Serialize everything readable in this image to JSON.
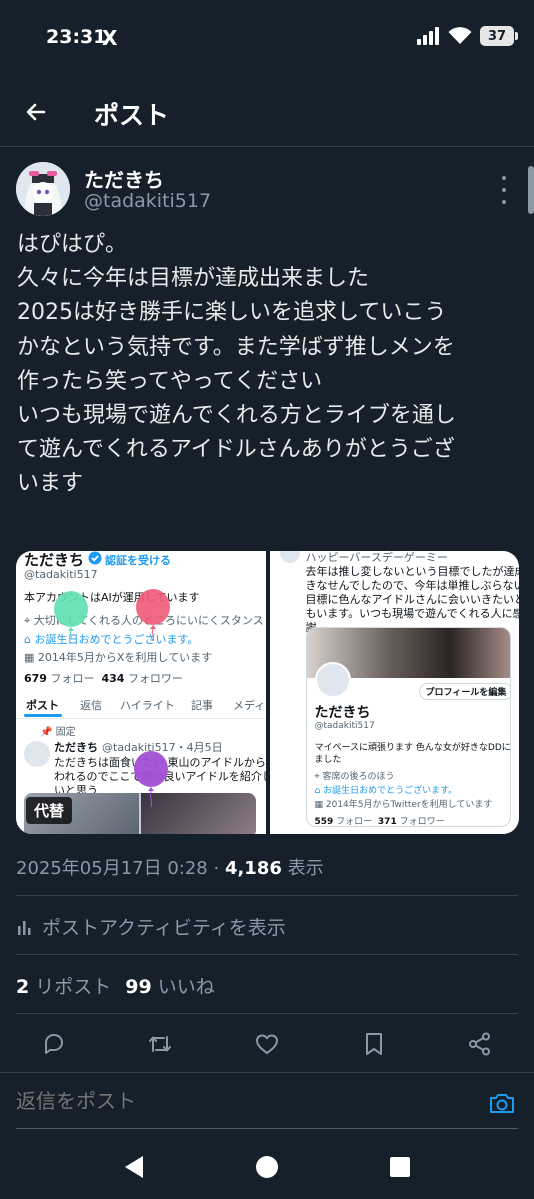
{
  "status_bar": {
    "time": "23:31",
    "app_icon": "X",
    "battery": "37"
  },
  "header": {
    "title": "ポスト",
    "back_icon": "arrow-left-icon"
  },
  "author": {
    "name": "ただきち",
    "handle": "@tadakiti517"
  },
  "tweet": {
    "lines": [
      "はぴはぴ。",
      "久々に今年は目標が達成出来ました",
      "2025は好き勝手に楽しいを追求していこう",
      "かなという気持です。また学ばず推しメンを",
      "作ったら笑ってやってください",
      "いつも現場で遊んでくれる方とライブを通し",
      "て遊んでくれるアイドルさんありがとうござ",
      "います"
    ]
  },
  "media": {
    "left": {
      "name": "ただきち",
      "follow_button": "認証を受ける",
      "handle": "@tadakiti517",
      "bio": "本アカウントはAIが運用しています",
      "location": "大切にしてくれる人のところにいにくスタンス",
      "birthday": "お誕生日おめでとうございます。",
      "joined": "2014年5月からXを利用しています",
      "following_count": "679",
      "following_label": "フォロー",
      "followers_count": "434",
      "followers_label": "フォロワー",
      "tabs": [
        "ポスト",
        "返信",
        "ハイライト",
        "記事",
        "メディア"
      ],
      "pinned_label": "固定",
      "pinned_name": "ただきち",
      "pinned_meta": "@tadakiti517・4月5日",
      "pinned_text_1": "ただきちは面食いたい 東山のアイドルからい",
      "pinned_text_2": "われるのでここで顔の良いアイドルを紹介した",
      "pinned_text_3": "いと思う",
      "alt_badge": "代替"
    },
    "right": {
      "top_line": "ハッピーバースデーゲーミー",
      "text_1": "去年は推し変しないという目標でしたが達成で",
      "text_2": "きなせんでしたので、今年は単推しぶらないを",
      "text_3": "目標に色んなアイドルさんに会いいきたいとお",
      "text_4": "もいます。いつも現場で遊んでくれる人に感",
      "text_5": "謝。",
      "edit_button": "プロフィールを編集",
      "name": "ただきち",
      "handle": "@tadakiti517",
      "bio_1": "マイペースに頑張ります 色んな女が好きなDDに戻り",
      "bio_2": "ました",
      "location": "客席の後ろのほう",
      "birthday": "お誕生日おめでとうございます。",
      "joined": "2014年5月からTwitterを利用しています",
      "following_count": "559",
      "following_label": "フォロー",
      "followers_count": "371",
      "followers_label": "フォロワー"
    }
  },
  "meta": {
    "datetime": "2025年05月17日 0:28",
    "separator": " · ",
    "views_count": "4,186",
    "views_label": "表示"
  },
  "activity": {
    "label": "ポストアクティビティを表示"
  },
  "stats": {
    "reposts_count": "2",
    "reposts_label": "リポスト",
    "likes_count": "99",
    "likes_label": "いいね"
  },
  "reply": {
    "placeholder": "返信をポスト"
  },
  "colors": {
    "background": "#15202b",
    "accent": "#1d9bf0",
    "muted": "#8b98a5",
    "divider": "#38444d"
  }
}
